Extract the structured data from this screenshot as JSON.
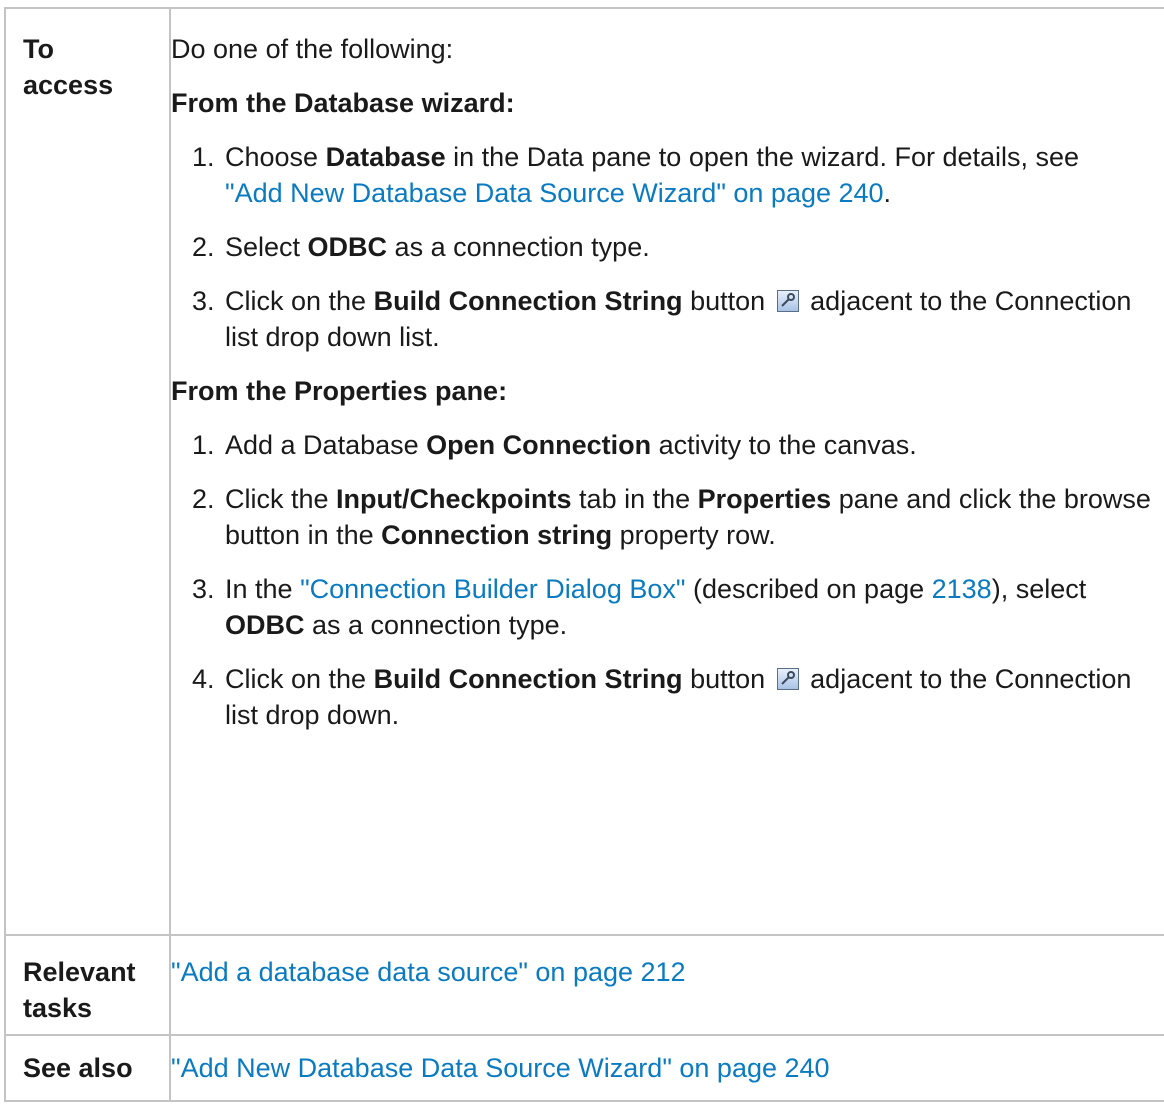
{
  "rows": {
    "access": {
      "label": "To access",
      "intro": "Do one of the following:",
      "wizard_heading": "From the Database wizard:",
      "wizard_steps": [
        {
          "num": "1.",
          "pre": "Choose ",
          "bold": "Database",
          "mid": " in the Data pane to open the wizard. For details, see ",
          "link": "\"Add New Database Data Source Wizard\" on page 240",
          "post": "."
        },
        {
          "num": "2.",
          "pre": "Select ",
          "bold": "ODBC",
          "post": " as a connection type."
        },
        {
          "num": "3.",
          "pre": "Click on the ",
          "bold": "Build Connection String",
          "mid": " button",
          "post": " adjacent to the Connection list drop down list."
        }
      ],
      "props_heading": "From the Properties pane:",
      "props_steps": [
        {
          "num": "1.",
          "pre": "Add a Database ",
          "bold": "Open Connection",
          "post": " activity to the canvas."
        },
        {
          "num": "2.",
          "pre": "Click the ",
          "bold": "Input/Checkpoints",
          "mid": " tab in the ",
          "bold2": "Properties",
          "mid2": " pane and click the browse button in the ",
          "bold3": "Connection string",
          "post": " property row."
        },
        {
          "num": "3.",
          "pre": "In the ",
          "link": "\"Connection Builder Dialog Box\"",
          "mid": " (described on page ",
          "link2": "2138",
          "mid2": "), select ",
          "bold": "ODBC",
          "post": " as a connection type."
        },
        {
          "num": "4.",
          "pre": "Click on the ",
          "bold": "Build Connection String",
          "mid": " button",
          "post": " adjacent to the Connection list drop down."
        }
      ],
      "icon": "build-connection-string-icon"
    },
    "tasks": {
      "label": "Relevant tasks",
      "link": "\"Add a database data source\" on page 212"
    },
    "see_also": {
      "label": "See also",
      "link": "\"Add New Database Data Source Wizard\" on page 240"
    }
  },
  "colors": {
    "link": "#0a7bc1",
    "border": "#c4c4c4",
    "text": "#1a1a1a"
  }
}
